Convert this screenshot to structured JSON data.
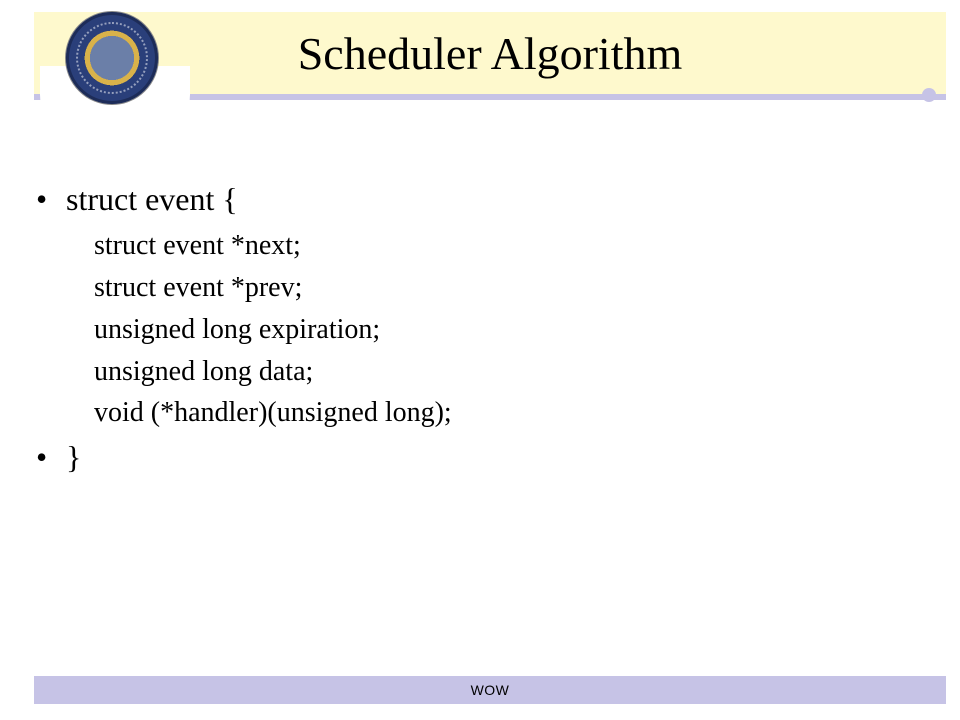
{
  "title": "Scheduler Algorithm",
  "body": {
    "items": [
      "struct event {",
      "}"
    ],
    "subitems": [
      "struct event *next;",
      "struct event *prev;",
      "unsigned long expiration;",
      "unsigned long data;",
      "void (*handler)(unsigned long);"
    ]
  },
  "footer": "WOW",
  "colors": {
    "title_bg": "#fef9cd",
    "accent": "#c6c3e6",
    "seal_primary": "#2a3f7a"
  }
}
